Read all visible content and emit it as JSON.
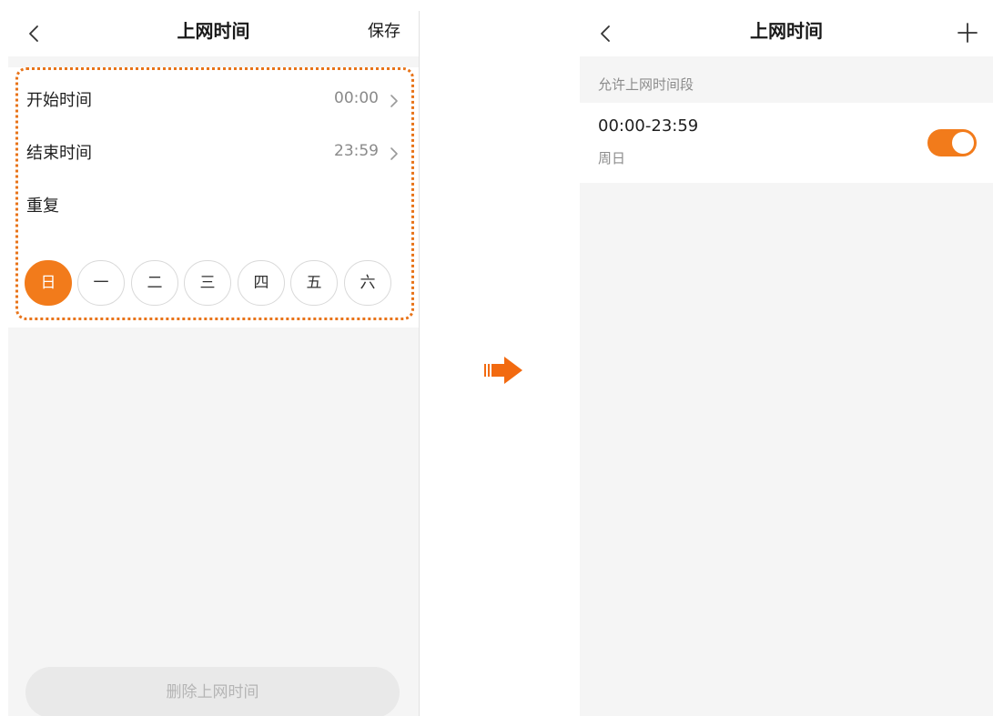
{
  "left_screen": {
    "title": "上网时间",
    "save_label": "保存",
    "start_time": {
      "label": "开始时间",
      "value": "00:00"
    },
    "end_time": {
      "label": "结束时间",
      "value": "23:59"
    },
    "repeat_label": "重复",
    "weekdays": [
      {
        "label": "日",
        "selected": true
      },
      {
        "label": "一",
        "selected": false
      },
      {
        "label": "二",
        "selected": false
      },
      {
        "label": "三",
        "selected": false
      },
      {
        "label": "四",
        "selected": false
      },
      {
        "label": "五",
        "selected": false
      },
      {
        "label": "六",
        "selected": false
      }
    ],
    "delete_label": "删除上网时间"
  },
  "right_screen": {
    "title": "上网时间",
    "section_title": "允许上网时间段",
    "schedules": [
      {
        "time_range": "00:00-23:59",
        "days": "周日",
        "enabled": true
      }
    ]
  },
  "colors": {
    "accent": "#f27b1b",
    "highlight": "#e8741a",
    "background": "#f5f5f5"
  },
  "icons": {
    "back": "chevron-left-icon",
    "row_arrow": "chevron-right-icon",
    "add": "plus-icon",
    "flow": "arrow-right-icon"
  }
}
